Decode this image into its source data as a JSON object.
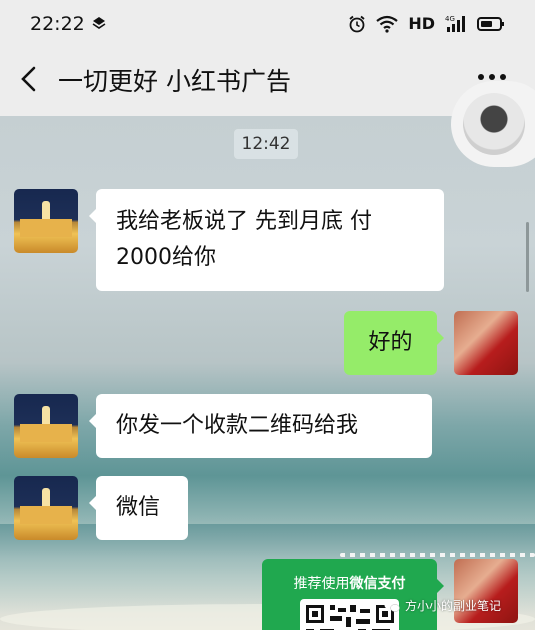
{
  "status_bar": {
    "time": "22:22",
    "hd_label": "HD",
    "signal_label": "4G"
  },
  "header": {
    "title": "一切更好 小红书广告"
  },
  "chat": {
    "timestamp": "12:42",
    "messages": [
      {
        "side": "in",
        "text": "我给老板说了 先到月底 付2000给你"
      },
      {
        "side": "out",
        "text": "好的"
      },
      {
        "side": "in",
        "text": "你发一个收款二维码给我"
      },
      {
        "side": "in",
        "text": "微信"
      }
    ],
    "payment_card": {
      "label_prefix": "推荐使用",
      "label_bold": "微信支付"
    }
  },
  "watermark": {
    "text": "方小小的副业笔记"
  },
  "colors": {
    "outgoing_bubble": "#95ec69",
    "incoming_bubble": "#ffffff",
    "payment_card": "#20a84f",
    "header_bg": "#ededed"
  }
}
